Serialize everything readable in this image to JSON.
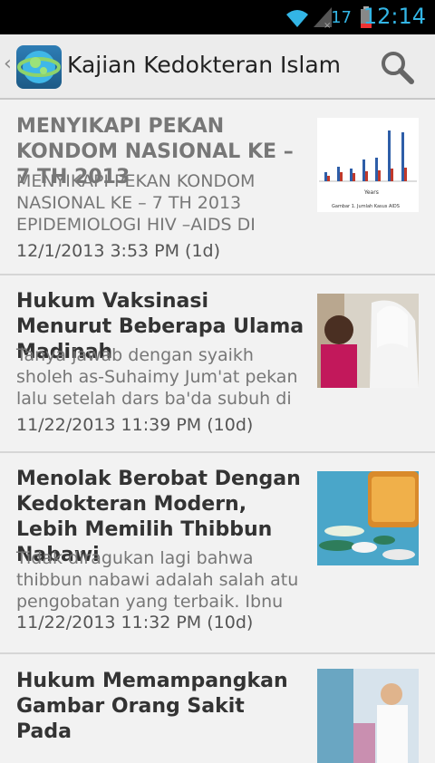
{
  "statusbar": {
    "battery": "17",
    "time": "12:14"
  },
  "actionbar": {
    "title": "Kajian Kedokteran Islam"
  },
  "articles": [
    {
      "title": "MENYIKAPI PEKAN KONDOM NASIONAL KE – 7 TH 2013",
      "summary": "MENYIKAPI PEKAN KONDOM\nNASIONAL KE – 7 TH 2013\nEPIDEMIOLOGI HIV –AIDS DI",
      "date": "12/1/2013 3:53 PM (1d)",
      "thumb_caption": "Gambar 1. Jumlah Kasus AIDS",
      "thumb_axis": "Years"
    },
    {
      "title": "Hukum Vaksinasi Menurut Beberapa Ulama Madinah",
      "summary": "Tanya jawab dengan syaikh\nsholeh as-Suhaimy Jum'at pekan\nlalu setelah dars ba'da subuh di",
      "date": "11/22/2013 11:39 PM (10d)"
    },
    {
      "title": "Menolak Berobat Dengan Kedokteran Modern, Lebih Memilih Thibbun Nabawi",
      "summary": "Tidak diragukan lagi bahwa\nthibbun nabawi adalah salah atu\npengobatan yang terbaik. Ibnu",
      "date": "11/22/2013 11:32 PM (10d)"
    },
    {
      "title": "Hukum Memampangkan Gambar Orang Sakit Pada",
      "summary": "",
      "date": ""
    }
  ]
}
